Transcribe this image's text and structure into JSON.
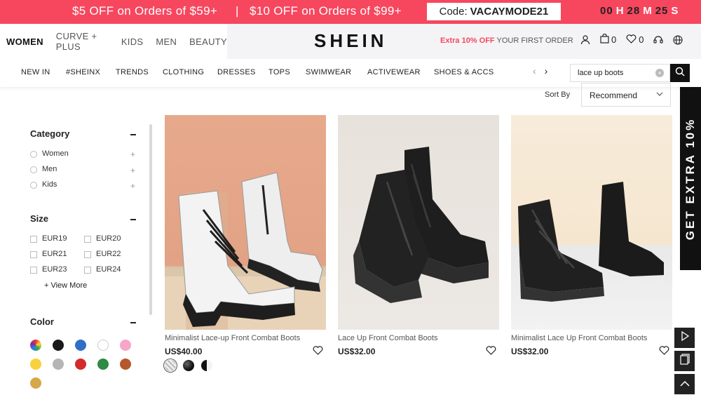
{
  "promo": {
    "offer1": "$5 OFF on Orders of $59+",
    "separator": "|",
    "offer2": "$10 OFF  on Orders of $99+",
    "code_label": "Code:",
    "code_value": "VACAYMODE21",
    "timer": {
      "hours": "00",
      "h_unit": "H",
      "minutes": "28",
      "m_unit": "M",
      "seconds": "25",
      "s_unit": "S"
    }
  },
  "header": {
    "categories": [
      "WOMEN",
      "CURVE + PLUS",
      "KIDS",
      "MEN",
      "BEAUTY"
    ],
    "logo": "SHEIN",
    "extra_prefix": "Extra 10% OFF",
    "extra_suffix": " YOUR FIRST ORDER",
    "cart_count": "0",
    "wishlist_count": "0"
  },
  "nav": {
    "items": [
      "NEW IN",
      "#SHEINX",
      "TRENDS",
      "CLOTHING",
      "DRESSES",
      "TOPS",
      "SWIMWEAR",
      "ACTIVEWEAR",
      "SHOES & ACCS"
    ],
    "prev_arrow": "‹",
    "next_arrow": "›",
    "search_value": "lace up boots"
  },
  "sort": {
    "label": "Sort By",
    "selected": "Recommend"
  },
  "filters": {
    "category": {
      "title": "Category",
      "options": [
        "Women",
        "Men",
        "Kids"
      ]
    },
    "size": {
      "title": "Size",
      "options": [
        "EUR19",
        "EUR20",
        "EUR21",
        "EUR22",
        "EUR23",
        "EUR24"
      ],
      "view_more": "+ View More"
    },
    "color": {
      "title": "Color",
      "swatches": [
        "#multi",
        "#1a1a1a",
        "#2f6fc6",
        "#ffffff",
        "#f7a5c8",
        "#f8d23c",
        "#b5b5b5",
        "#d42a2a",
        "#2e8a45",
        "#b5582c",
        "#d6a84a"
      ]
    }
  },
  "products": [
    {
      "name": "Minimalist Lace-up Front Combat Boots",
      "price": "US$40.00"
    },
    {
      "name": "Lace Up Front Combat Boots",
      "price": "US$32.00"
    },
    {
      "name": "Minimalist Lace Up Front Combat Boots",
      "price": "US$32.00"
    }
  ],
  "side_banner": "GET EXTRA 10%",
  "colors": {
    "brand_red": "#f6475f",
    "dark": "#111111"
  }
}
